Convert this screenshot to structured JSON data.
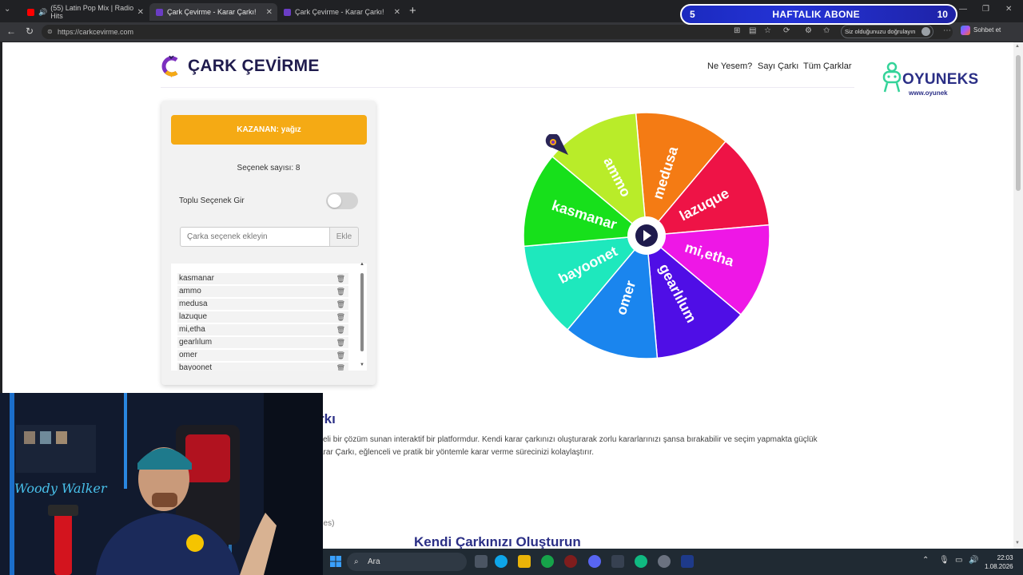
{
  "browser": {
    "tabs": [
      {
        "title": "(55) Latin Pop Mix | Radio Hits",
        "favicon_color": "#ff0000"
      },
      {
        "title": "Çark Çevirme - Karar Çarkı!",
        "favicon_color": "#6a3dc4"
      },
      {
        "title": "Çark Çevirme - Karar Çarkı!",
        "favicon_color": "#6a3dc4"
      }
    ],
    "url": "https://carkcevirme.com",
    "verify_text": "Siz olduğunuzu doğrulayın",
    "chat_label": "Sohbet et"
  },
  "overlay": {
    "left_num": "5",
    "label": "HAFTALIK ABONE",
    "right_num": "10"
  },
  "site": {
    "logo_text": "ÇARK ÇEVİRME",
    "nav": [
      "Ne Yesem?",
      "Sayı Çarkı",
      "Tüm Çarklar"
    ],
    "partner_logo": "OYUNEKS",
    "partner_sub": "www.oyunek"
  },
  "panel": {
    "winner_text": "KAZANAN: yağız",
    "count_text": "Seçenek sayısı: 8",
    "bulk_label": "Toplu Seçenek Gir",
    "bulk_enabled": false,
    "input_placeholder": "Çarka seçenek ekleyin",
    "add_label": "Ekle",
    "items": [
      "kasmanar",
      "ammo",
      "medusa",
      "lazuque",
      "mi,etha",
      "gearlılum",
      "omer",
      "bayoonet"
    ]
  },
  "wheel": {
    "segments": [
      {
        "label": "medusa",
        "color": "#f47b14"
      },
      {
        "label": "lazuque",
        "color": "#ee1346"
      },
      {
        "label": "mi,etha",
        "color": "#ee17e6"
      },
      {
        "label": "gearlılum",
        "color": "#4f0ee6"
      },
      {
        "label": "omer",
        "color": "#1a85ee"
      },
      {
        "label": "bayoonet",
        "color": "#1ee8bd"
      },
      {
        "label": "kasmanar",
        "color": "#17e01b"
      },
      {
        "label": "ammo",
        "color": "#b9ec29"
      }
    ]
  },
  "content": {
    "about_title": "rkı",
    "about_p1": "celi bir çözüm sunan interaktif bir platformdur. Kendi karar çarkınızı oluşturarak zorlu kararlarınızı şansa bırakabilir ve seçim yapmakta güçlük",
    "about_p2": "arar Çarkı, eğlenceli ve pratik bir yöntemle karar verme sürecinizi kolaylaştırır.",
    "misc": "des)",
    "own_title": "Kendi Çarkınızı Oluşturun"
  },
  "taskbar": {
    "search_label": "Ara",
    "time": "22:03",
    "date": "1.08.2026"
  },
  "colors": {
    "winner": "#f5aa14",
    "brand_dark": "#1f1b4d",
    "heading": "#2b2f86"
  }
}
